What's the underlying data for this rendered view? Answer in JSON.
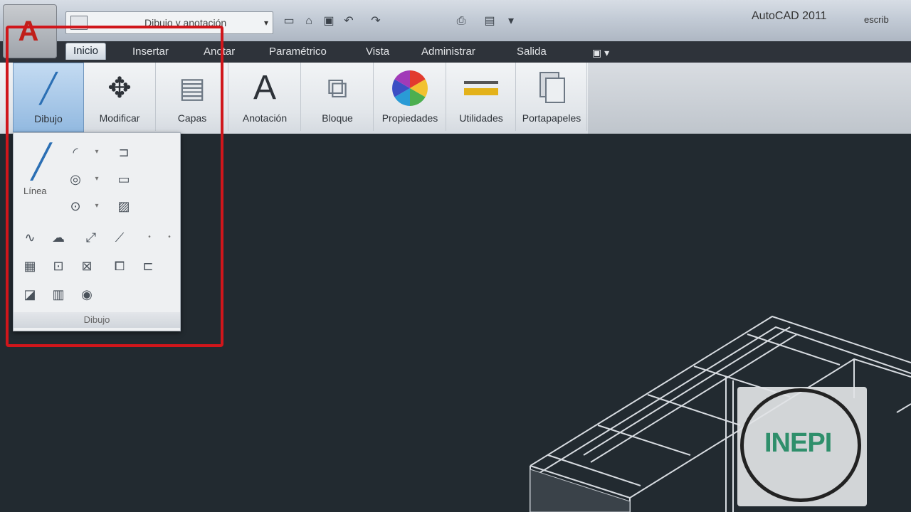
{
  "titlebar": {
    "workspace_value": "Dibujo y anotación",
    "app_title": "AutoCAD 2011",
    "help_text": "escrib",
    "app_button_letter": "A",
    "quick_access_icons": [
      "new-icon",
      "open-icon",
      "save-icon",
      "undo-icon",
      "redo-icon",
      "plot-icon",
      "print-icon",
      "dropdown-icon"
    ]
  },
  "tabs": [
    {
      "label": "Inicio",
      "active": true
    },
    {
      "label": "Insertar"
    },
    {
      "label": "Anotar"
    },
    {
      "label": "Paramétrico"
    },
    {
      "label": "Vista"
    },
    {
      "label": "Administrar"
    },
    {
      "label": "Salida"
    }
  ],
  "tab_extra": "▣ ▾",
  "ribbon": {
    "buttons": [
      {
        "label": "Dibujo",
        "icon": "draw-icon",
        "glyph": "╱",
        "active": true
      },
      {
        "label": "Modificar",
        "icon": "move-icon",
        "glyph": "✥"
      },
      {
        "label": "Capas",
        "icon": "layers-icon",
        "glyph": "▤"
      },
      {
        "label": "Anotación",
        "icon": "text-icon",
        "glyph": "A"
      },
      {
        "label": "Bloque",
        "icon": "block-icon",
        "glyph": "⧉"
      },
      {
        "label": "Propiedades",
        "icon": "color-wheel-icon",
        "glyph": "●"
      },
      {
        "label": "Utilidades",
        "icon": "measure-icon",
        "glyph": "▬"
      },
      {
        "label": "Portapapeles",
        "icon": "clipboard-icon",
        "glyph": "📋"
      }
    ]
  },
  "draw_panel": {
    "line_label": "Línea",
    "title": "Dibujo",
    "icons": [
      "line-icon",
      "arc-icon",
      "circle-icon",
      "ellipse-icon",
      "polyline-icon",
      "rectangle-icon",
      "hatch-icon",
      "spline-icon",
      "revision-cloud-icon",
      "ray-icon",
      "construction-line-icon",
      "region-icon",
      "boundary-icon",
      "wipeout-icon",
      "table-icon",
      "point-icon",
      "gradient-icon",
      "donut-icon",
      "helix-icon"
    ]
  },
  "watermark": {
    "text": "INEPI"
  },
  "colors": {
    "highlight": "#d0161b",
    "canvas_bg": "#222a30",
    "watermark_text": "#2f8f6b"
  }
}
